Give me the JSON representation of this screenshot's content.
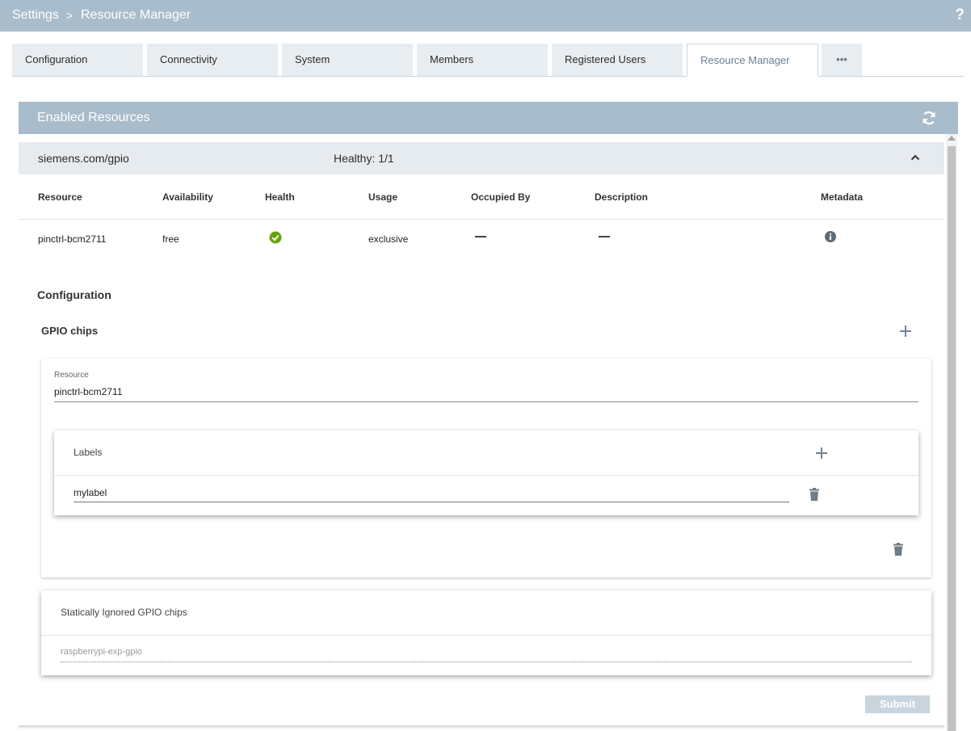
{
  "breadcrumb": {
    "root": "Settings",
    "separator": ">",
    "current": "Resource Manager"
  },
  "help_label": "?",
  "tabs": [
    {
      "label": "Configuration"
    },
    {
      "label": "Connectivity"
    },
    {
      "label": "System"
    },
    {
      "label": "Members"
    },
    {
      "label": "Registered Users"
    },
    {
      "label": "Resource Manager",
      "active": true
    },
    {
      "label": "•••"
    }
  ],
  "panel": {
    "title": "Enabled Resources"
  },
  "resource": {
    "name": "siemens.com/gpio",
    "health": "Healthy: 1/1"
  },
  "table": {
    "headers": [
      "Resource",
      "Availability",
      "Health",
      "Usage",
      "Occupied By",
      "Description",
      "Metadata"
    ],
    "rows": [
      {
        "resource": "pinctrl-bcm2711",
        "availability": "free",
        "health": "ok",
        "usage": "exclusive",
        "occupied_by": "—",
        "description": "—",
        "metadata": "info-icon"
      }
    ]
  },
  "configuration": {
    "heading": "Configuration",
    "gpio_chips_heading": "GPIO chips",
    "chip": {
      "field_label": "Resource",
      "field_value": "pinctrl-bcm2711",
      "labels_title": "Labels",
      "label_value": "mylabel"
    },
    "ignored": {
      "title": "Statically Ignored GPIO chips",
      "placeholder": "raspberrypi-exp-gpio"
    }
  },
  "submit_label": "Submit",
  "colors": {
    "header": "#a9bccb",
    "tab_bg": "#e8edf2",
    "health_ok": "#65a30d"
  }
}
